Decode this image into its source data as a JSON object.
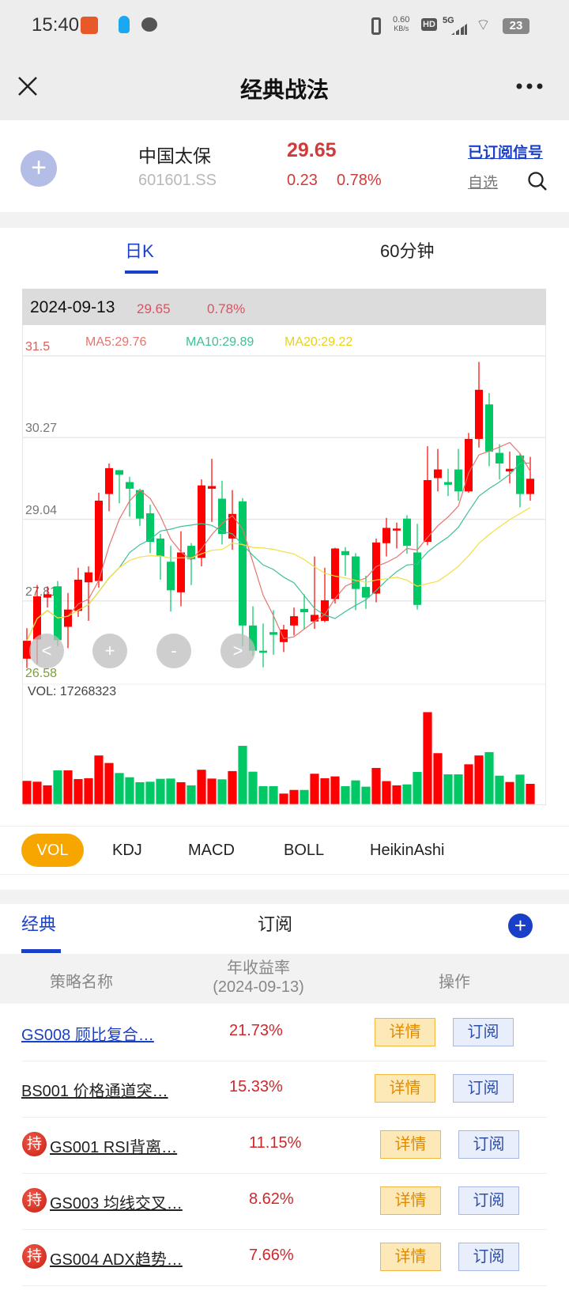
{
  "status_bar": {
    "time": "15:40",
    "net_speed": "0.60",
    "net_unit": "KB/s",
    "hd": "HD",
    "network": "5G",
    "battery": "23"
  },
  "nav": {
    "title": "经典战法",
    "close_icon": "close-icon",
    "more_icon": "more-icon"
  },
  "stock": {
    "name": "中国太保",
    "code": "601601.SS",
    "price": "29.65",
    "change": "0.23",
    "change_pct": "0.78%",
    "subscribed_label": "已订阅信号",
    "watchlist_label": "自选",
    "up_color": "#d23a3a"
  },
  "period_tabs": [
    {
      "label": "日K",
      "active": true
    },
    {
      "label": "60分钟",
      "active": false
    }
  ],
  "chart_header": {
    "date": "2024-09-13",
    "close": "29.65",
    "pct": "0.78%"
  },
  "ma_legend": {
    "ma5": "MA5:29.76",
    "ma10": "MA10:29.89",
    "ma20": "MA20:29.22"
  },
  "nav_buttons": [
    "<",
    "+",
    "-",
    ">"
  ],
  "vol_label": "VOL: 17268323",
  "chart_data": {
    "type": "candlestick",
    "y_ticks": [
      "31.5",
      "30.27",
      "29.04",
      "27.81",
      "26.58"
    ],
    "ylim": [
      26.58,
      31.5
    ],
    "grid": true,
    "colors": {
      "up": "#ff0000",
      "down": "#00c864",
      "ma5": "#e8736f",
      "ma10": "#3fbf9a",
      "ma20": "#f0e040"
    },
    "ohlc": [
      [
        26.94,
        27.4,
        26.8,
        27.21
      ],
      [
        27.23,
        28.05,
        26.86,
        27.88
      ],
      [
        27.86,
        28.03,
        27.71,
        27.91
      ],
      [
        28.03,
        28.11,
        27.13,
        27.22
      ],
      [
        27.42,
        27.93,
        27.1,
        27.68
      ],
      [
        27.66,
        28.31,
        27.57,
        28.13
      ],
      [
        28.09,
        28.33,
        27.51,
        28.24
      ],
      [
        28.11,
        29.44,
        28.01,
        29.32
      ],
      [
        29.42,
        29.88,
        29.16,
        29.81
      ],
      [
        29.78,
        29.78,
        29.28,
        29.71
      ],
      [
        29.6,
        29.68,
        29.08,
        29.5
      ],
      [
        29.48,
        29.5,
        28.94,
        29.05
      ],
      [
        29.13,
        29.26,
        28.53,
        28.7
      ],
      [
        28.75,
        28.82,
        28.13,
        28.48
      ],
      [
        28.4,
        28.64,
        27.65,
        27.97
      ],
      [
        27.94,
        28.86,
        27.73,
        28.54
      ],
      [
        28.64,
        28.68,
        28.05,
        28.44
      ],
      [
        28.46,
        29.64,
        28.33,
        29.55
      ],
      [
        29.5,
        29.95,
        29.0,
        29.54
      ],
      [
        29.35,
        29.62,
        28.66,
        28.82
      ],
      [
        28.75,
        29.48,
        28.58,
        29.12
      ],
      [
        29.31,
        29.36,
        27.13,
        27.44
      ],
      [
        27.44,
        27.73,
        26.98,
        27.06
      ],
      [
        27.06,
        27.47,
        26.81,
        27.03
      ],
      [
        27.34,
        27.67,
        27.0,
        27.3
      ],
      [
        27.19,
        27.45,
        27.04,
        27.38
      ],
      [
        27.44,
        27.71,
        27.29,
        27.58
      ],
      [
        27.69,
        27.91,
        27.39,
        27.64
      ],
      [
        27.5,
        28.48,
        27.39,
        27.6
      ],
      [
        27.51,
        28.31,
        27.49,
        27.82
      ],
      [
        27.84,
        28.61,
        27.77,
        28.6
      ],
      [
        28.56,
        28.62,
        28.19,
        28.5
      ],
      [
        28.48,
        28.53,
        27.67,
        27.99
      ],
      [
        28.02,
        28.19,
        27.69,
        27.86
      ],
      [
        27.92,
        28.75,
        27.79,
        28.69
      ],
      [
        28.68,
        29.06,
        28.48,
        28.91
      ],
      [
        28.87,
        28.99,
        28.6,
        28.9
      ],
      [
        29.05,
        29.1,
        28.52,
        28.64
      ],
      [
        28.54,
        28.97,
        27.68,
        27.75
      ],
      [
        28.7,
        30.14,
        28.65,
        29.63
      ],
      [
        29.66,
        30.1,
        29.46,
        29.79
      ],
      [
        29.6,
        29.8,
        29.39,
        29.56
      ],
      [
        29.79,
        30.1,
        29.32,
        29.46
      ],
      [
        29.46,
        30.34,
        29.44,
        30.25
      ],
      [
        30.25,
        31.41,
        30.12,
        30.99
      ],
      [
        30.77,
        30.94,
        29.84,
        30.06
      ],
      [
        30.04,
        30.17,
        29.64,
        29.88
      ],
      [
        29.76,
        30.06,
        29.58,
        29.8
      ],
      [
        30.0,
        30.03,
        29.22,
        29.42
      ],
      [
        29.42,
        29.98,
        29.32,
        29.65
      ]
    ],
    "volume": [
      19700000,
      19000000,
      16000000,
      28400000,
      28400000,
      21200000,
      21900000,
      40700000,
      34500000,
      26200000,
      22700000,
      18600000,
      19000000,
      21400000,
      21600000,
      18600000,
      16000000,
      28900000,
      21600000,
      21000000,
      27800000,
      48700000,
      27300000,
      15300000,
      15300000,
      9200000,
      12200000,
      12200000,
      25600000,
      21900000,
      23400000,
      15300000,
      20100000,
      14900000,
      30400000,
      19500000,
      16000000,
      16800000,
      27100000,
      76500000,
      42600000,
      25100000,
      25100000,
      33400000,
      40700000,
      43500000,
      24000000,
      18800000,
      24900000,
      17268323
    ]
  },
  "indicator_tabs": [
    {
      "label": "VOL",
      "active": true
    },
    {
      "label": "KDJ"
    },
    {
      "label": "MACD"
    },
    {
      "label": "BOLL"
    },
    {
      "label": "HeikinAshi"
    }
  ],
  "strategy_tabs": [
    {
      "label": "经典",
      "active": true
    },
    {
      "label": "订阅"
    }
  ],
  "table": {
    "headers": {
      "name": "策略名称",
      "return": "年收益率",
      "return_date": "(2024-09-13)",
      "action": "操作"
    },
    "rows": [
      {
        "name": "GS008 顾比复合…",
        "pct": "21.73%",
        "held": false,
        "highlight": true
      },
      {
        "name": "BS001 价格通道突…",
        "pct": "15.33%",
        "held": false
      },
      {
        "name": "GS001 RSI背离…",
        "pct": "11.15%",
        "held": true
      },
      {
        "name": "GS003 均线交叉…",
        "pct": "8.62%",
        "held": true
      },
      {
        "name": "GS004 ADX趋势…",
        "pct": "7.66%",
        "held": true
      }
    ],
    "held_badge": "持",
    "detail_label": "详情",
    "subscribe_label": "订阅"
  }
}
